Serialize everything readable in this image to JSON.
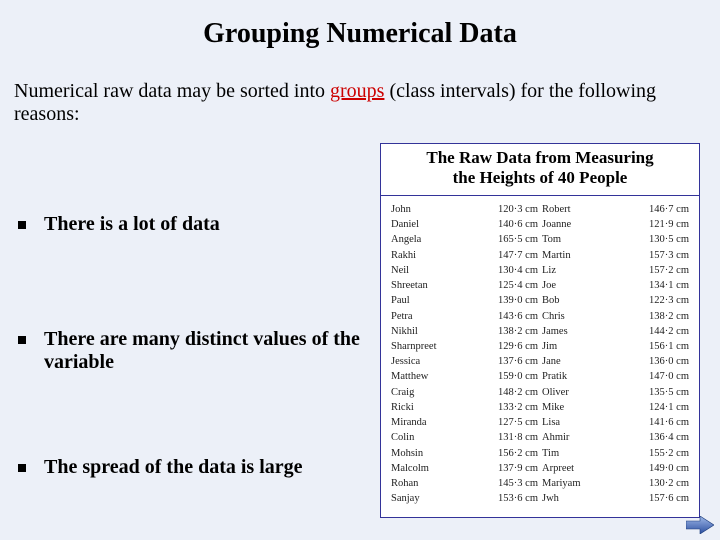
{
  "title": "Grouping Numerical Data",
  "intro": {
    "pre": "Numerical raw data may be sorted into ",
    "keyword": "groups",
    "post": " (class intervals) for the following reasons:"
  },
  "table": {
    "header_l1": "The Raw Data from Measuring",
    "header_l2": "the Heights of 40 People"
  },
  "bullets": {
    "b1": "There is a lot of data",
    "b2": "There are many distinct values of the variable",
    "b3": "The spread of the data is large"
  },
  "raw_data": {
    "left": [
      {
        "name": "John",
        "value": "120·3 cm"
      },
      {
        "name": "Daniel",
        "value": "140·6 cm"
      },
      {
        "name": "Angela",
        "value": "165·5 cm"
      },
      {
        "name": "Rakhi",
        "value": "147·7 cm"
      },
      {
        "name": "Neil",
        "value": "130·4 cm"
      },
      {
        "name": "Shreetan",
        "value": "125·4 cm"
      },
      {
        "name": "Paul",
        "value": "139·0 cm"
      },
      {
        "name": "Petra",
        "value": "143·6 cm"
      },
      {
        "name": "Nikhil",
        "value": "138·2 cm"
      },
      {
        "name": "Sharnpreet",
        "value": "129·6 cm"
      },
      {
        "name": "Jessica",
        "value": "137·6 cm"
      },
      {
        "name": "Matthew",
        "value": "159·0 cm"
      },
      {
        "name": "Craig",
        "value": "148·2 cm"
      },
      {
        "name": "Ricki",
        "value": "133·2 cm"
      },
      {
        "name": "Miranda",
        "value": "127·5 cm"
      },
      {
        "name": "Colin",
        "value": "131·8 cm"
      },
      {
        "name": "Mohsin",
        "value": "156·2 cm"
      },
      {
        "name": "Malcolm",
        "value": "137·9 cm"
      },
      {
        "name": "Rohan",
        "value": "145·3 cm"
      },
      {
        "name": "Sanjay",
        "value": "153·6 cm"
      }
    ],
    "right": [
      {
        "name": "Robert",
        "value": "146·7 cm"
      },
      {
        "name": "Joanne",
        "value": "121·9 cm"
      },
      {
        "name": "Tom",
        "value": "130·5 cm"
      },
      {
        "name": "Martin",
        "value": "157·3 cm"
      },
      {
        "name": "Liz",
        "value": "157·2 cm"
      },
      {
        "name": "Joe",
        "value": "134·1 cm"
      },
      {
        "name": "Bob",
        "value": "122·3 cm"
      },
      {
        "name": "Chris",
        "value": "138·2 cm"
      },
      {
        "name": "James",
        "value": "144·2 cm"
      },
      {
        "name": "Jim",
        "value": "156·1 cm"
      },
      {
        "name": "Jane",
        "value": "136·0 cm"
      },
      {
        "name": "Pratik",
        "value": "147·0 cm"
      },
      {
        "name": "Oliver",
        "value": "135·5 cm"
      },
      {
        "name": "Mike",
        "value": "124·1 cm"
      },
      {
        "name": "Lisa",
        "value": "141·6 cm"
      },
      {
        "name": "Ahmir",
        "value": "136·4 cm"
      },
      {
        "name": "Tim",
        "value": "155·2 cm"
      },
      {
        "name": "Arpreet",
        "value": "149·0 cm"
      },
      {
        "name": "Mariyam",
        "value": "130·2 cm"
      },
      {
        "name": "Jwh",
        "value": "157·6 cm"
      }
    ]
  },
  "nav": {
    "next_label": "next-slide"
  }
}
